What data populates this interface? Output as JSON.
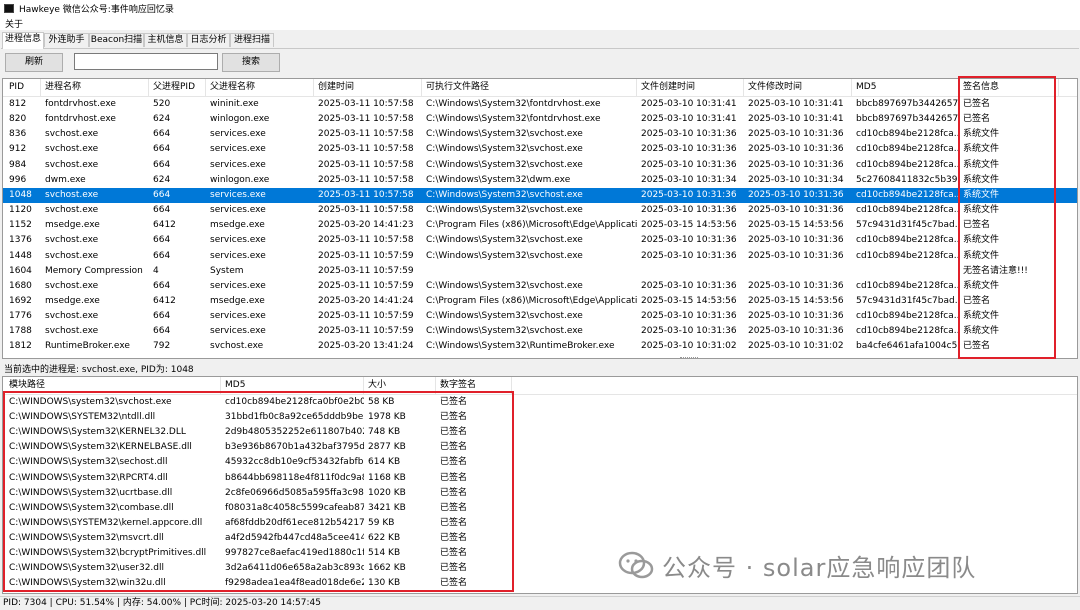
{
  "window": {
    "title": "Hawkeye 微信公众号:事件响应回忆录"
  },
  "menu": {
    "about": "关于"
  },
  "tabs": [
    "进程信息",
    "外连助手",
    "Beacon扫描",
    "主机信息",
    "日志分析",
    "进程扫描"
  ],
  "toolbar": {
    "refresh_label": "刷新",
    "search_label": "搜索",
    "search_value": ""
  },
  "process_table": {
    "columns": [
      "PID",
      "进程名称",
      "父进程PID",
      "父进程名称",
      "创建时间",
      "可执行文件路径",
      "文件创建时间",
      "文件修改时间",
      "MD5",
      "签名信息"
    ],
    "rows": [
      [
        "812",
        "fontdrvhost.exe",
        "520",
        "wininit.exe",
        "2025-03-11 10:57:58",
        "C:\\Windows\\System32\\fontdrvhost.exe",
        "2025-03-10 10:31:41",
        "2025-03-10 10:31:41",
        "bbcb897697b3442657...",
        "已签名"
      ],
      [
        "820",
        "fontdrvhost.exe",
        "624",
        "winlogon.exe",
        "2025-03-11 10:57:58",
        "C:\\Windows\\System32\\fontdrvhost.exe",
        "2025-03-10 10:31:41",
        "2025-03-10 10:31:41",
        "bbcb897697b3442657...",
        "已签名"
      ],
      [
        "836",
        "svchost.exe",
        "664",
        "services.exe",
        "2025-03-11 10:57:58",
        "C:\\Windows\\System32\\svchost.exe",
        "2025-03-10 10:31:36",
        "2025-03-10 10:31:36",
        "cd10cb894be2128fca...",
        "系统文件"
      ],
      [
        "912",
        "svchost.exe",
        "664",
        "services.exe",
        "2025-03-11 10:57:58",
        "C:\\Windows\\System32\\svchost.exe",
        "2025-03-10 10:31:36",
        "2025-03-10 10:31:36",
        "cd10cb894be2128fca...",
        "系统文件"
      ],
      [
        "984",
        "svchost.exe",
        "664",
        "services.exe",
        "2025-03-11 10:57:58",
        "C:\\Windows\\System32\\svchost.exe",
        "2025-03-10 10:31:36",
        "2025-03-10 10:31:36",
        "cd10cb894be2128fca...",
        "系统文件"
      ],
      [
        "996",
        "dwm.exe",
        "624",
        "winlogon.exe",
        "2025-03-11 10:57:58",
        "C:\\Windows\\System32\\dwm.exe",
        "2025-03-10 10:31:34",
        "2025-03-10 10:31:34",
        "5c27608411832c5b39...",
        "系统文件"
      ],
      [
        "1048",
        "svchost.exe",
        "664",
        "services.exe",
        "2025-03-11 10:57:58",
        "C:\\Windows\\System32\\svchost.exe",
        "2025-03-10 10:31:36",
        "2025-03-10 10:31:36",
        "cd10cb894be2128fca...",
        "系统文件"
      ],
      [
        "1120",
        "svchost.exe",
        "664",
        "services.exe",
        "2025-03-11 10:57:58",
        "C:\\Windows\\System32\\svchost.exe",
        "2025-03-10 10:31:36",
        "2025-03-10 10:31:36",
        "cd10cb894be2128fca...",
        "系统文件"
      ],
      [
        "1152",
        "msedge.exe",
        "6412",
        "msedge.exe",
        "2025-03-20 14:41:23",
        "C:\\Program Files (x86)\\Microsoft\\Edge\\Applicati...",
        "2025-03-15 14:53:56",
        "2025-03-15 14:53:56",
        "57c9431d31f45c7bad...",
        "已签名"
      ],
      [
        "1376",
        "svchost.exe",
        "664",
        "services.exe",
        "2025-03-11 10:57:58",
        "C:\\Windows\\System32\\svchost.exe",
        "2025-03-10 10:31:36",
        "2025-03-10 10:31:36",
        "cd10cb894be2128fca...",
        "系统文件"
      ],
      [
        "1448",
        "svchost.exe",
        "664",
        "services.exe",
        "2025-03-11 10:57:59",
        "C:\\Windows\\System32\\svchost.exe",
        "2025-03-10 10:31:36",
        "2025-03-10 10:31:36",
        "cd10cb894be2128fca...",
        "系统文件"
      ],
      [
        "1604",
        "Memory Compression",
        "4",
        "System",
        "2025-03-11 10:57:59",
        "",
        "",
        "",
        "",
        "无签名请注意!!!"
      ],
      [
        "1680",
        "svchost.exe",
        "664",
        "services.exe",
        "2025-03-11 10:57:59",
        "C:\\Windows\\System32\\svchost.exe",
        "2025-03-10 10:31:36",
        "2025-03-10 10:31:36",
        "cd10cb894be2128fca...",
        "系统文件"
      ],
      [
        "1692",
        "msedge.exe",
        "6412",
        "msedge.exe",
        "2025-03-20 14:41:24",
        "C:\\Program Files (x86)\\Microsoft\\Edge\\Applicati...",
        "2025-03-15 14:53:56",
        "2025-03-15 14:53:56",
        "57c9431d31f45c7bad...",
        "已签名"
      ],
      [
        "1776",
        "svchost.exe",
        "664",
        "services.exe",
        "2025-03-11 10:57:59",
        "C:\\Windows\\System32\\svchost.exe",
        "2025-03-10 10:31:36",
        "2025-03-10 10:31:36",
        "cd10cb894be2128fca...",
        "系统文件"
      ],
      [
        "1788",
        "svchost.exe",
        "664",
        "services.exe",
        "2025-03-11 10:57:59",
        "C:\\Windows\\System32\\svchost.exe",
        "2025-03-10 10:31:36",
        "2025-03-10 10:31:36",
        "cd10cb894be2128fca...",
        "系统文件"
      ],
      [
        "1812",
        "RuntimeBroker.exe",
        "792",
        "svchost.exe",
        "2025-03-20 13:41:24",
        "C:\\Windows\\System32\\RuntimeBroker.exe",
        "2025-03-10 10:31:02",
        "2025-03-10 10:31:02",
        "ba4cfe6461afa1004c5...",
        "已签名"
      ]
    ],
    "selected_pid": "1048"
  },
  "selection_status": "当前选中的进程是: svchost.exe, PID为: 1048",
  "module_table": {
    "columns": [
      "模块路径",
      "MD5",
      "大小",
      "数字签名"
    ],
    "rows": [
      [
        "C:\\WINDOWS\\system32\\svchost.exe",
        "cd10cb894be2128fca0bf0e2b0...",
        "58 KB",
        "已签名"
      ],
      [
        "C:\\WINDOWS\\SYSTEM32\\ntdll.dll",
        "31bbd1fb0c8a92ce65dddb9be...",
        "1978 KB",
        "已签名"
      ],
      [
        "C:\\WINDOWS\\System32\\KERNEL32.DLL",
        "2d9b4805352252e611807b402...",
        "748 KB",
        "已签名"
      ],
      [
        "C:\\WINDOWS\\System32\\KERNELBASE.dll",
        "b3e936b8670b1a432baf3795d...",
        "2877 KB",
        "已签名"
      ],
      [
        "C:\\WINDOWS\\System32\\sechost.dll",
        "45932cc8db10e9cf53432fabfb...",
        "614 KB",
        "已签名"
      ],
      [
        "C:\\WINDOWS\\System32\\RPCRT4.dll",
        "b8644bb698118e4f811f0dc9a8...",
        "1168 KB",
        "已签名"
      ],
      [
        "C:\\WINDOWS\\System32\\ucrtbase.dll",
        "2c8fe06966d5085a595ffa3c98f...",
        "1020 KB",
        "已签名"
      ],
      [
        "C:\\WINDOWS\\System32\\combase.dll",
        "f08031a8c4058c5599cafeab87...",
        "3421 KB",
        "已签名"
      ],
      [
        "C:\\WINDOWS\\SYSTEM32\\kernel.appcore.dll",
        "af68fddb20df61ece812b54217...",
        "59 KB",
        "已签名"
      ],
      [
        "C:\\WINDOWS\\System32\\msvcrt.dll",
        "a4f2d5942fb447cd48a5cee414...",
        "622 KB",
        "已签名"
      ],
      [
        "C:\\WINDOWS\\System32\\bcryptPrimitives.dll",
        "997827ce8aefac419ed1880c1f...",
        "514 KB",
        "已签名"
      ],
      [
        "C:\\WINDOWS\\System32\\user32.dll",
        "3d2a6411d06e658a2ab3c893c...",
        "1662 KB",
        "已签名"
      ],
      [
        "C:\\WINDOWS\\System32\\win32u.dll",
        "f9298adea1ea4f8ead018de6e2...",
        "130 KB",
        "已签名"
      ]
    ]
  },
  "watermark": "公众号 · solar应急响应团队",
  "status_bar": "PID: 7304 | CPU: 51.54% | 内存: 54.00% | PC时间: 2025-03-20 14:57:45",
  "colors": {
    "selection": "#0078d7",
    "highlight_box": "#e0202a"
  }
}
